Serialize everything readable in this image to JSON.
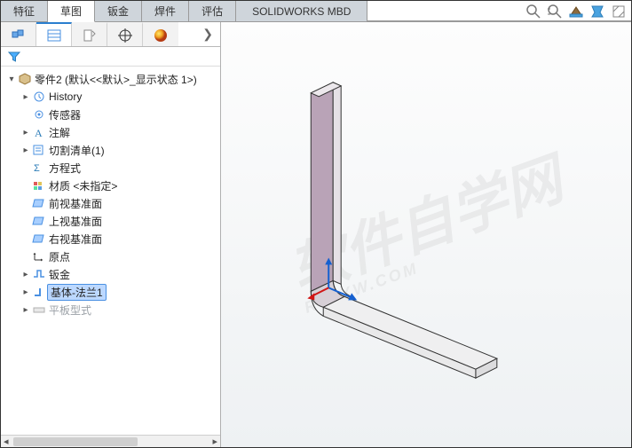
{
  "tabs": {
    "t0": "特征",
    "t1": "草图",
    "t2": "钣金",
    "t3": "焊件",
    "t4": "评估",
    "t5": "SOLIDWORKS MBD"
  },
  "tree": {
    "root": "零件2  (默认<<默认>_显示状态 1>)",
    "history": "History",
    "sensors": "传感器",
    "annotations": "注解",
    "cutlist": "切割清单(1)",
    "equations": "方程式",
    "material": "材质 <未指定>",
    "front": "前视基准面",
    "top": "上视基准面",
    "right": "右视基准面",
    "origin": "原点",
    "sheetmetal": "钣金",
    "baseflange": "基体-法兰1",
    "flatpattern": "平板型式"
  },
  "toolstrip": {
    "zoom": "zoom",
    "fit": "fit",
    "section": "section",
    "appearance": "appearance",
    "settings": "settings"
  },
  "watermark": {
    "main": "软件自学网",
    "sub": "RJZXW.COM"
  }
}
